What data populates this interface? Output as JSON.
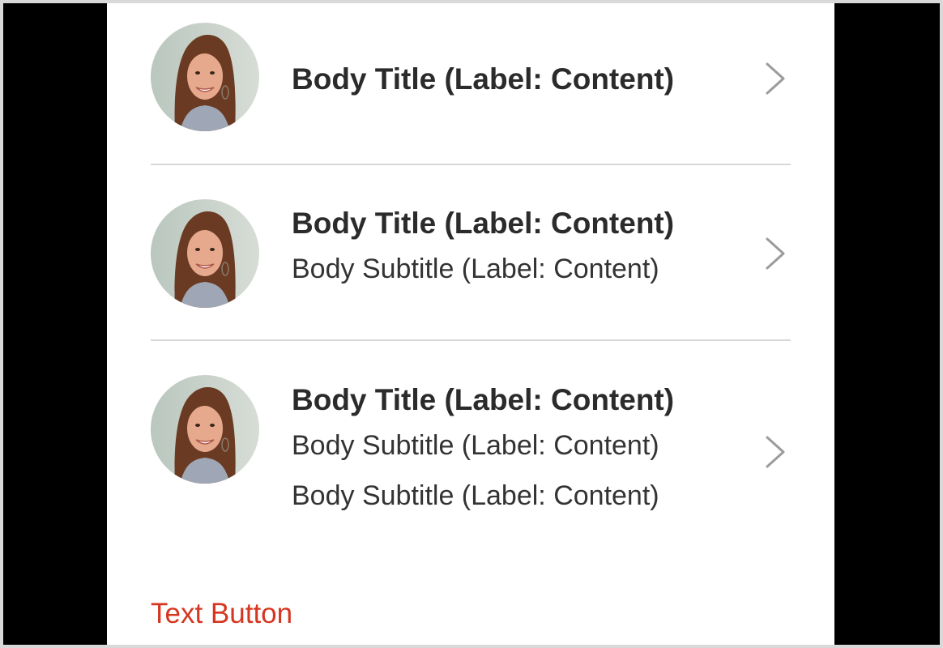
{
  "list": {
    "items": [
      {
        "avatar_icon": "person-photo-icon",
        "title": "Body Title (Label: Content)",
        "subtitles": []
      },
      {
        "avatar_icon": "person-photo-icon",
        "title": "Body Title (Label: Content)",
        "subtitles": [
          "Body Subtitle (Label: Content)"
        ]
      },
      {
        "avatar_icon": "person-photo-icon",
        "title": "Body Title (Label: Content)",
        "subtitles": [
          "Body Subtitle (Label: Content)",
          "Body Subtitle (Label: Content)"
        ]
      }
    ],
    "chevron_icon": "chevron-right-icon"
  },
  "footer": {
    "text_button_label": "Text Button"
  },
  "colors": {
    "accent": "#d6361f",
    "text": "#2b2b2b",
    "divider": "#d8d8d8",
    "chevron": "#9b9b9b",
    "background": "#ffffff",
    "outer": "#000000"
  }
}
